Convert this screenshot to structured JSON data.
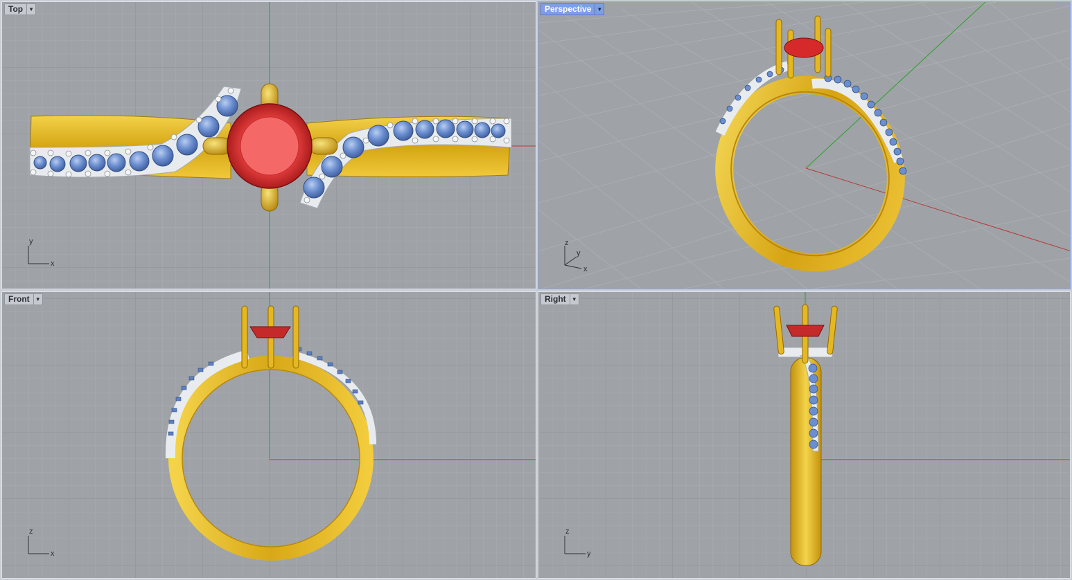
{
  "viewports": {
    "top": {
      "label": "Top",
      "axis_h": "x",
      "axis_v": "y"
    },
    "perspective": {
      "label": "Perspective",
      "axis_x": "x",
      "axis_y": "y",
      "axis_z": "z",
      "active": true
    },
    "front": {
      "label": "Front",
      "axis_h": "x",
      "axis_v": "z"
    },
    "right": {
      "label": "Right",
      "axis_h": "y",
      "axis_v": "z"
    }
  },
  "icons": {
    "dropdown": "chevron-down-icon"
  },
  "colors": {
    "viewport_bg": "#9fa3a7",
    "grid_minor": "#a9adb1",
    "grid_major": "#8d9196",
    "x_axis": "#b63a3a",
    "y_axis": "#2aa02a",
    "gold": "#e0b21c",
    "silver": "#e8ebee",
    "blue_gem": "#6a8ed0",
    "ruby": "#e03a3a",
    "active_label": "#7f9ee8"
  }
}
